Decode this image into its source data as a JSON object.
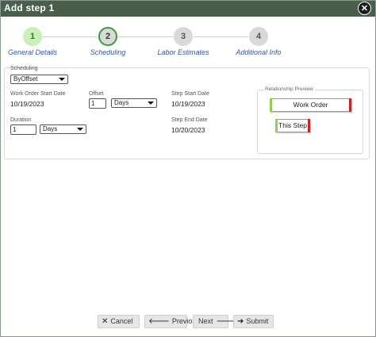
{
  "dialog": {
    "title": "Add step 1",
    "close_glyph": "✕"
  },
  "stepper": {
    "steps": [
      {
        "number": "1",
        "label": "General Details",
        "state": "done"
      },
      {
        "number": "2",
        "label": "Scheduling",
        "state": "active"
      },
      {
        "number": "3",
        "label": "Labor Estimates",
        "state": "pending"
      },
      {
        "number": "4",
        "label": "Additional Info",
        "state": "pending"
      }
    ]
  },
  "form": {
    "scheduling_label": "Scheduling",
    "scheduling_value": "ByOffset",
    "wo_start_label": "Work Order Start Date",
    "wo_start_value": "10/19/2023",
    "offset_label": "Offset",
    "offset_value": "1",
    "offset_unit": "Days",
    "step_start_label": "Step Start Date",
    "step_start_value": "10/19/2023",
    "duration_label": "Duration",
    "duration_value": "1",
    "duration_unit": "Days",
    "step_end_label": "Step End Date",
    "step_end_value": "10/20/2023"
  },
  "preview": {
    "legend": "Relationship Preview",
    "work_order": "Work Order",
    "this_step": "This Step",
    "colors": {
      "start": "#8fd04f",
      "end": "#c0262a"
    }
  },
  "footer": {
    "cancel": "Cancel",
    "previous": "Previous",
    "next": "Next",
    "submit": "Submit",
    "icons": {
      "cancel": "close-icon",
      "previous": "arrow-left-icon",
      "next": "arrow-right-icon",
      "submit": "submit-arrow-icon"
    }
  }
}
